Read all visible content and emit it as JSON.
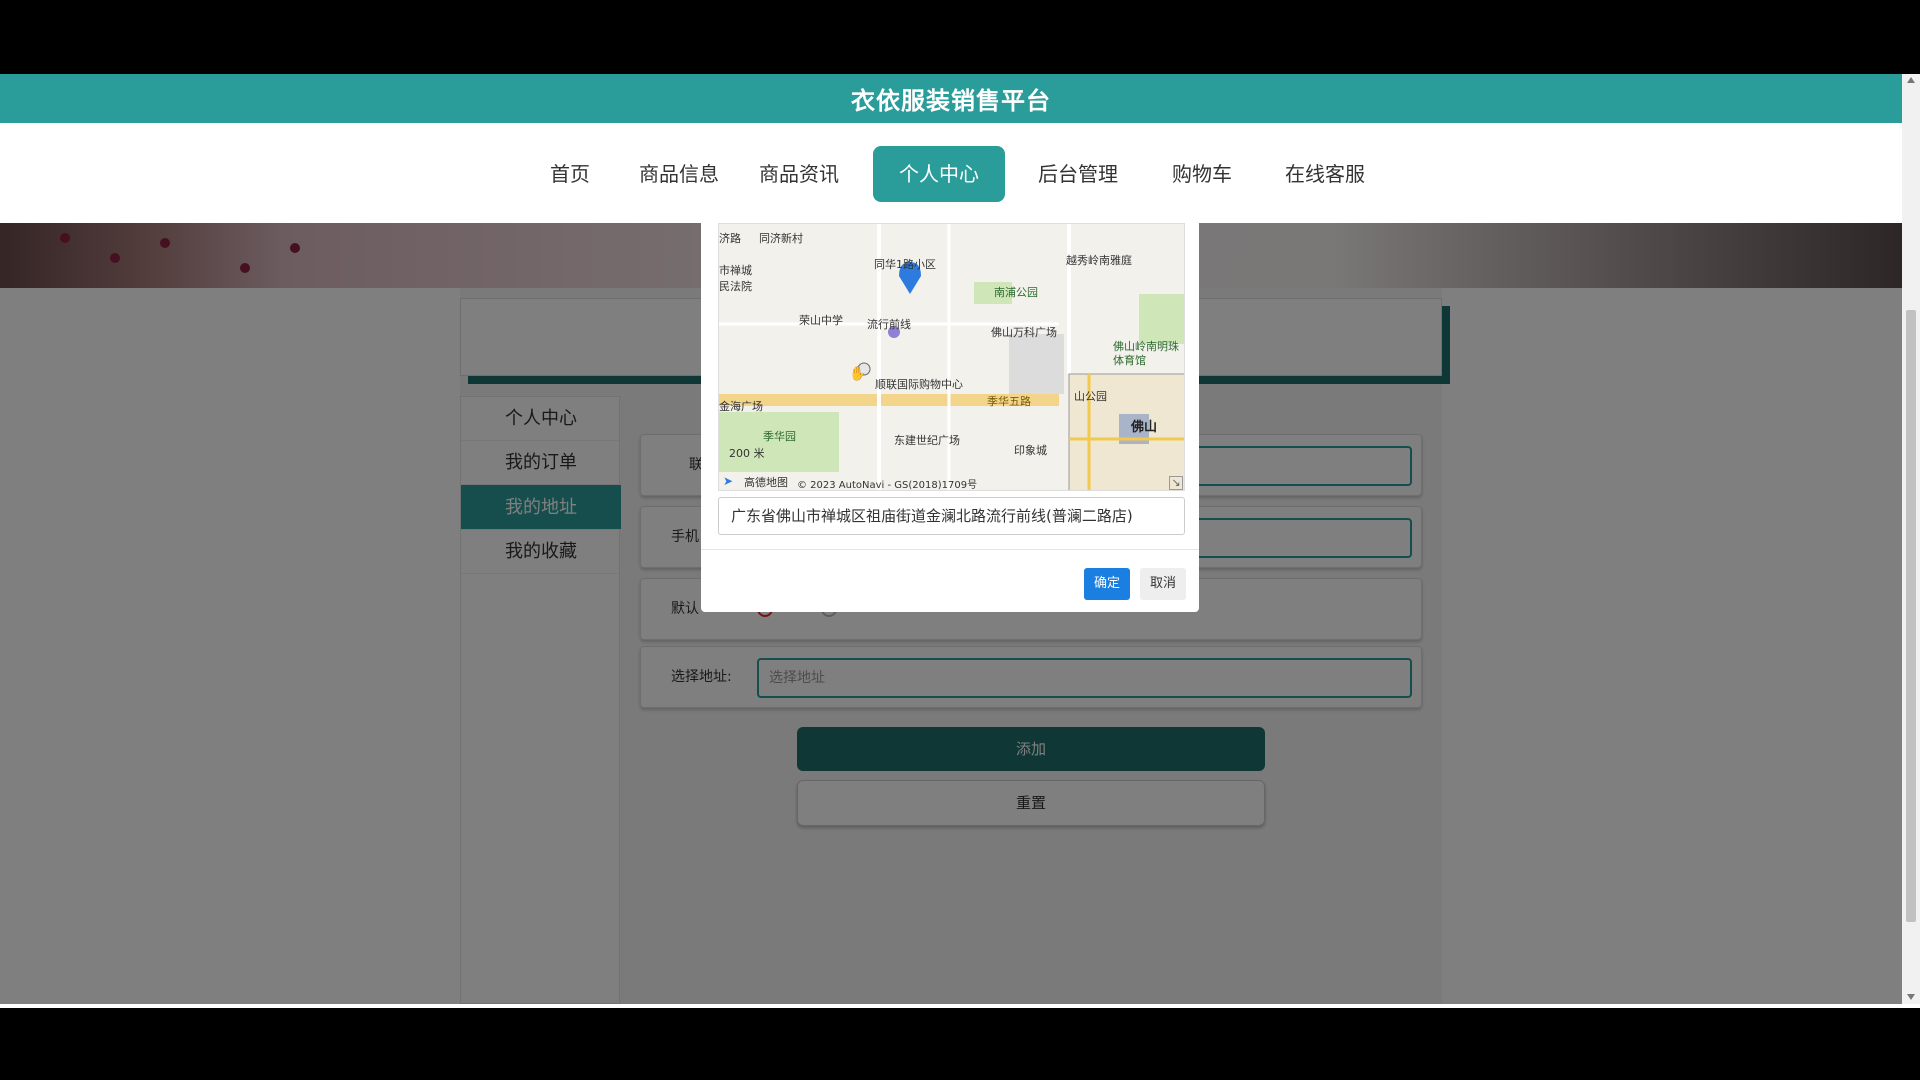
{
  "site": {
    "title": "衣依服装销售平台"
  },
  "nav": {
    "items": [
      {
        "label": "首页"
      },
      {
        "label": "商品信息"
      },
      {
        "label": "商品资讯"
      },
      {
        "label": "个人中心",
        "active": true
      },
      {
        "label": "后台管理"
      },
      {
        "label": "购物车"
      },
      {
        "label": "在线客服"
      }
    ]
  },
  "sidebar": {
    "items": [
      {
        "label": "个人中心"
      },
      {
        "label": "我的订单"
      },
      {
        "label": "我的地址",
        "active": true
      },
      {
        "label": "我的收藏"
      }
    ]
  },
  "form": {
    "contact_label": "联",
    "phone_label": "手机",
    "default_label": "默认",
    "address_label": "选择地址:",
    "address_placeholder": "选择地址",
    "add_button": "添加",
    "reset_button": "重置"
  },
  "dialog": {
    "address_value": "广东省佛山市禅城区祖庙街道金澜北路流行前线(普澜二路店)",
    "ok_button": "确定",
    "cancel_button": "取消"
  },
  "map": {
    "labels": {
      "l1": "同济新村",
      "l2": "同华1路小区",
      "l3": "越秀岭南雅庭",
      "l4": "南浦公园",
      "l5": "荣山中学",
      "l6": "流行前线",
      "l7": "佛山万科广场",
      "l8": "佛山岭南明珠体育馆",
      "l9": "顺联国际购物中心",
      "l10": "季华五路",
      "l11": "金海广场",
      "l12": "季华园",
      "l13": "东建世纪广场",
      "l14": "印象城",
      "l15": "佛山",
      "l16": "山公园",
      "l17": "市禅城",
      "l18": "民法院",
      "l19": "济路",
      "scale": "200 米",
      "copyright": "© 2023 AutoNavi - GS(2018)1709号",
      "logo": "高德地图"
    }
  },
  "colors": {
    "accent": "#2a9d9a",
    "accent_dark": "#1e6f6d",
    "primary_button": "#1a7fe0"
  }
}
